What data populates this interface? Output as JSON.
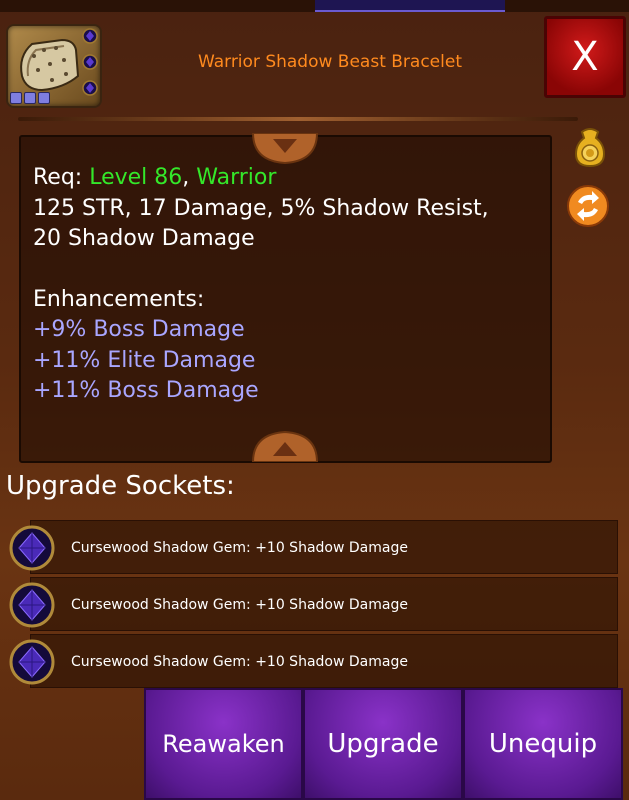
{
  "item": {
    "title": "Warrior Shadow Beast Bracelet",
    "icon": "bracelet-icon"
  },
  "close_label": "X",
  "description": {
    "req_label": "Req: ",
    "req_level": "Level 86",
    "req_sep": ", ",
    "req_class": "Warrior",
    "stats_line1": "125 STR, 17 Damage, 5% Shadow Resist,",
    "stats_line2": "20 Shadow Damage",
    "enh_title": "Enhancements:",
    "enhancements": [
      "+9% Boss Damage",
      "+11% Elite Damage",
      "+11% Boss Damage"
    ]
  },
  "side_icons": [
    "gold-bag-icon",
    "swap-icon"
  ],
  "sockets": {
    "title": "Upgrade Sockets:",
    "items": [
      "Cursewood Shadow Gem: +10 Shadow Damage",
      "Cursewood Shadow Gem: +10 Shadow Damage",
      "Cursewood Shadow Gem: +10 Shadow Damage"
    ]
  },
  "buttons": {
    "reawaken": "Reawaken",
    "upgrade": "Upgrade",
    "unequip": "Unequip"
  },
  "colors": {
    "title": "#ff8a1e",
    "req_green": "#34e82a",
    "enhancement_purple": "#a9a6ff",
    "button_purple": "#6a22a8",
    "close_red": "#c01010"
  }
}
